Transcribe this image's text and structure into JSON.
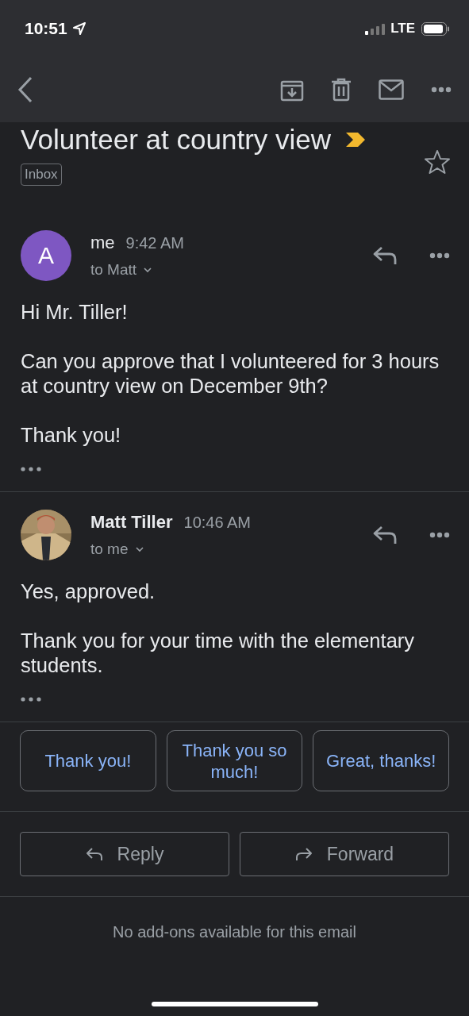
{
  "status_bar": {
    "time": "10:51",
    "network": "LTE"
  },
  "subject": {
    "title": "Volunteer at country view",
    "important": true,
    "label": "Inbox",
    "starred": false
  },
  "messages": [
    {
      "sender": "me",
      "unread": false,
      "time": "9:42 AM",
      "recipients": "to Matt",
      "avatar": {
        "kind": "letter",
        "letter": "A",
        "color": "#7e57c2"
      },
      "paragraphs": [
        "Hi Mr. Tiller!",
        "Can you approve that I volunteered for 3 hours at country view on December 9th?",
        "Thank you!"
      ]
    },
    {
      "sender": "Matt Tiller",
      "unread": true,
      "time": "10:46 AM",
      "recipients": "to me",
      "avatar": {
        "kind": "picture"
      },
      "paragraphs": [
        "Yes, approved.",
        "Thank you for your time with the elementary students."
      ]
    }
  ],
  "smart_replies": [
    "Thank you!",
    "Thank you so much!",
    "Great, thanks!"
  ],
  "actions": [
    {
      "kind": "reply",
      "label": "Reply"
    },
    {
      "kind": "forward",
      "label": "Forward"
    }
  ],
  "addons_note": "No add-ons available for this email"
}
